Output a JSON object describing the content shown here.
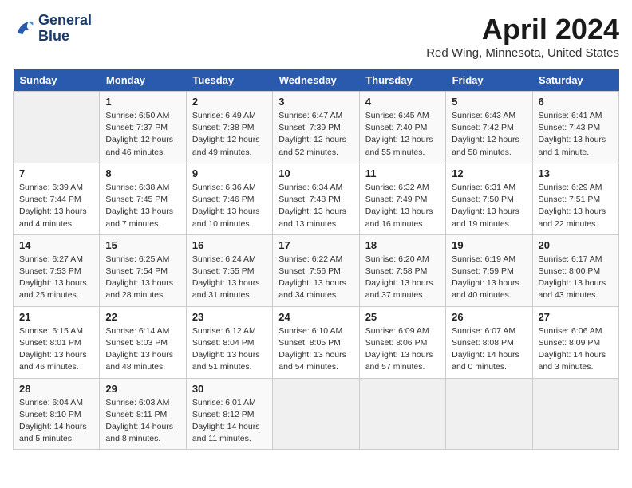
{
  "header": {
    "logo_line1": "General",
    "logo_line2": "Blue",
    "title": "April 2024",
    "subtitle": "Red Wing, Minnesota, United States"
  },
  "days_of_week": [
    "Sunday",
    "Monday",
    "Tuesday",
    "Wednesday",
    "Thursday",
    "Friday",
    "Saturday"
  ],
  "weeks": [
    [
      {
        "num": "",
        "info": ""
      },
      {
        "num": "1",
        "info": "Sunrise: 6:50 AM\nSunset: 7:37 PM\nDaylight: 12 hours\nand 46 minutes."
      },
      {
        "num": "2",
        "info": "Sunrise: 6:49 AM\nSunset: 7:38 PM\nDaylight: 12 hours\nand 49 minutes."
      },
      {
        "num": "3",
        "info": "Sunrise: 6:47 AM\nSunset: 7:39 PM\nDaylight: 12 hours\nand 52 minutes."
      },
      {
        "num": "4",
        "info": "Sunrise: 6:45 AM\nSunset: 7:40 PM\nDaylight: 12 hours\nand 55 minutes."
      },
      {
        "num": "5",
        "info": "Sunrise: 6:43 AM\nSunset: 7:42 PM\nDaylight: 12 hours\nand 58 minutes."
      },
      {
        "num": "6",
        "info": "Sunrise: 6:41 AM\nSunset: 7:43 PM\nDaylight: 13 hours\nand 1 minute."
      }
    ],
    [
      {
        "num": "7",
        "info": "Sunrise: 6:39 AM\nSunset: 7:44 PM\nDaylight: 13 hours\nand 4 minutes."
      },
      {
        "num": "8",
        "info": "Sunrise: 6:38 AM\nSunset: 7:45 PM\nDaylight: 13 hours\nand 7 minutes."
      },
      {
        "num": "9",
        "info": "Sunrise: 6:36 AM\nSunset: 7:46 PM\nDaylight: 13 hours\nand 10 minutes."
      },
      {
        "num": "10",
        "info": "Sunrise: 6:34 AM\nSunset: 7:48 PM\nDaylight: 13 hours\nand 13 minutes."
      },
      {
        "num": "11",
        "info": "Sunrise: 6:32 AM\nSunset: 7:49 PM\nDaylight: 13 hours\nand 16 minutes."
      },
      {
        "num": "12",
        "info": "Sunrise: 6:31 AM\nSunset: 7:50 PM\nDaylight: 13 hours\nand 19 minutes."
      },
      {
        "num": "13",
        "info": "Sunrise: 6:29 AM\nSunset: 7:51 PM\nDaylight: 13 hours\nand 22 minutes."
      }
    ],
    [
      {
        "num": "14",
        "info": "Sunrise: 6:27 AM\nSunset: 7:53 PM\nDaylight: 13 hours\nand 25 minutes."
      },
      {
        "num": "15",
        "info": "Sunrise: 6:25 AM\nSunset: 7:54 PM\nDaylight: 13 hours\nand 28 minutes."
      },
      {
        "num": "16",
        "info": "Sunrise: 6:24 AM\nSunset: 7:55 PM\nDaylight: 13 hours\nand 31 minutes."
      },
      {
        "num": "17",
        "info": "Sunrise: 6:22 AM\nSunset: 7:56 PM\nDaylight: 13 hours\nand 34 minutes."
      },
      {
        "num": "18",
        "info": "Sunrise: 6:20 AM\nSunset: 7:58 PM\nDaylight: 13 hours\nand 37 minutes."
      },
      {
        "num": "19",
        "info": "Sunrise: 6:19 AM\nSunset: 7:59 PM\nDaylight: 13 hours\nand 40 minutes."
      },
      {
        "num": "20",
        "info": "Sunrise: 6:17 AM\nSunset: 8:00 PM\nDaylight: 13 hours\nand 43 minutes."
      }
    ],
    [
      {
        "num": "21",
        "info": "Sunrise: 6:15 AM\nSunset: 8:01 PM\nDaylight: 13 hours\nand 46 minutes."
      },
      {
        "num": "22",
        "info": "Sunrise: 6:14 AM\nSunset: 8:03 PM\nDaylight: 13 hours\nand 48 minutes."
      },
      {
        "num": "23",
        "info": "Sunrise: 6:12 AM\nSunset: 8:04 PM\nDaylight: 13 hours\nand 51 minutes."
      },
      {
        "num": "24",
        "info": "Sunrise: 6:10 AM\nSunset: 8:05 PM\nDaylight: 13 hours\nand 54 minutes."
      },
      {
        "num": "25",
        "info": "Sunrise: 6:09 AM\nSunset: 8:06 PM\nDaylight: 13 hours\nand 57 minutes."
      },
      {
        "num": "26",
        "info": "Sunrise: 6:07 AM\nSunset: 8:08 PM\nDaylight: 14 hours\nand 0 minutes."
      },
      {
        "num": "27",
        "info": "Sunrise: 6:06 AM\nSunset: 8:09 PM\nDaylight: 14 hours\nand 3 minutes."
      }
    ],
    [
      {
        "num": "28",
        "info": "Sunrise: 6:04 AM\nSunset: 8:10 PM\nDaylight: 14 hours\nand 5 minutes."
      },
      {
        "num": "29",
        "info": "Sunrise: 6:03 AM\nSunset: 8:11 PM\nDaylight: 14 hours\nand 8 minutes."
      },
      {
        "num": "30",
        "info": "Sunrise: 6:01 AM\nSunset: 8:12 PM\nDaylight: 14 hours\nand 11 minutes."
      },
      {
        "num": "",
        "info": ""
      },
      {
        "num": "",
        "info": ""
      },
      {
        "num": "",
        "info": ""
      },
      {
        "num": "",
        "info": ""
      }
    ]
  ]
}
